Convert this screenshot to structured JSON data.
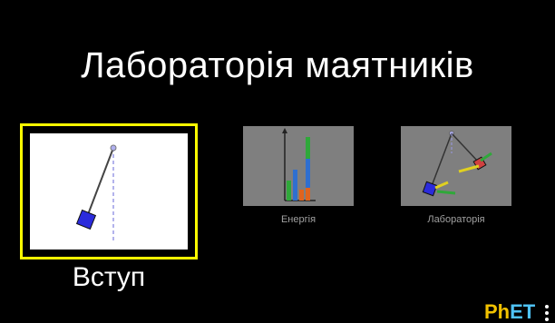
{
  "title": "Лабораторія маятників",
  "screens": [
    {
      "label": "Вступ",
      "selected": true
    },
    {
      "label": "Енергія",
      "selected": false
    },
    {
      "label": "Лабораторія",
      "selected": false
    }
  ],
  "brand": {
    "ph": "Ph",
    "et": "ET"
  },
  "colors": {
    "background": "#000000",
    "selection": "#ffff00",
    "thumbnail_bg": "#7f7f7f",
    "pendulum_blue": "#2b2bdc",
    "bar_green": "#2fa83a",
    "bar_blue": "#2f6fd0",
    "bar_orange": "#e0641e"
  },
  "icons": {
    "menu": "vertical-dots-menu-icon"
  }
}
